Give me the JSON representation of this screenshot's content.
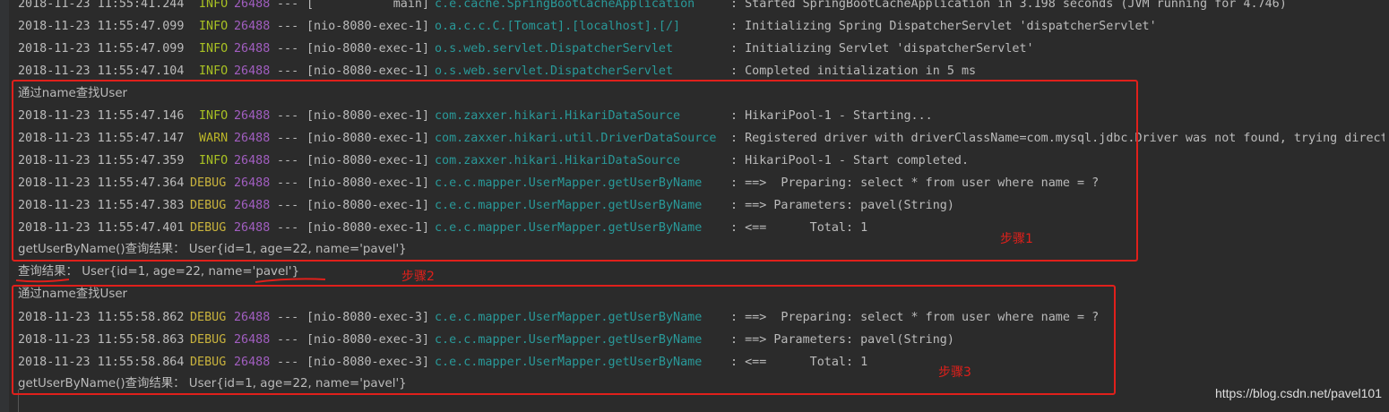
{
  "console": {
    "lines": [
      {
        "date": "2018-11-23 11:55:41.244",
        "level": "INFO",
        "pid": "26488",
        "sep": "---",
        "thread": "[           main]",
        "logger": "c.e.cache.SpringBootCacheApplication",
        "msg": ": Started SpringBootCacheApplication in 3.198 seconds (JVM running for 4.746)"
      },
      {
        "date": "2018-11-23 11:55:47.099",
        "level": "INFO",
        "pid": "26488",
        "sep": "---",
        "thread": "[nio-8080-exec-1]",
        "logger": "o.a.c.c.C.[Tomcat].[localhost].[/]",
        "msg": ": Initializing Spring DispatcherServlet 'dispatcherServlet'"
      },
      {
        "date": "2018-11-23 11:55:47.099",
        "level": "INFO",
        "pid": "26488",
        "sep": "---",
        "thread": "[nio-8080-exec-1]",
        "logger": "o.s.web.servlet.DispatcherServlet",
        "msg": ": Initializing Servlet 'dispatcherServlet'"
      },
      {
        "date": "2018-11-23 11:55:47.104",
        "level": "INFO",
        "pid": "26488",
        "sep": "---",
        "thread": "[nio-8080-exec-1]",
        "logger": "o.s.web.servlet.DispatcherServlet",
        "msg": ": Completed initialization in 5 ms"
      },
      {
        "plain": "通过name查找User"
      },
      {
        "date": "2018-11-23 11:55:47.146",
        "level": "INFO",
        "pid": "26488",
        "sep": "---",
        "thread": "[nio-8080-exec-1]",
        "logger": "com.zaxxer.hikari.HikariDataSource",
        "msg": ": HikariPool-1 - Starting..."
      },
      {
        "date": "2018-11-23 11:55:47.147",
        "level": "WARN",
        "pid": "26488",
        "sep": "---",
        "thread": "[nio-8080-exec-1]",
        "logger": "com.zaxxer.hikari.util.DriverDataSource",
        "msg": ": Registered driver with driverClassName=com.mysql.jdbc.Driver was not found, trying direct"
      },
      {
        "date": "2018-11-23 11:55:47.359",
        "level": "INFO",
        "pid": "26488",
        "sep": "---",
        "thread": "[nio-8080-exec-1]",
        "logger": "com.zaxxer.hikari.HikariDataSource",
        "msg": ": HikariPool-1 - Start completed."
      },
      {
        "date": "2018-11-23 11:55:47.364",
        "level": "DEBUG",
        "pid": "26488",
        "sep": "---",
        "thread": "[nio-8080-exec-1]",
        "logger": "c.e.c.mapper.UserMapper.getUserByName",
        "msg": ": ==>  Preparing: select * from user where name = ?"
      },
      {
        "date": "2018-11-23 11:55:47.383",
        "level": "DEBUG",
        "pid": "26488",
        "sep": "---",
        "thread": "[nio-8080-exec-1]",
        "logger": "c.e.c.mapper.UserMapper.getUserByName",
        "msg": ": ==> Parameters: pavel(String)"
      },
      {
        "date": "2018-11-23 11:55:47.401",
        "level": "DEBUG",
        "pid": "26488",
        "sep": "---",
        "thread": "[nio-8080-exec-1]",
        "logger": "c.e.c.mapper.UserMapper.getUserByName",
        "msg": ": <==      Total: 1"
      },
      {
        "plain": "getUserByName()查询结果： User{id=1, age=22, name='pavel'}"
      },
      {
        "plain": "查询结果： User{id=1, age=22, name='pavel'}"
      },
      {
        "plain": "通过name查找User"
      },
      {
        "date": "2018-11-23 11:55:58.862",
        "level": "DEBUG",
        "pid": "26488",
        "sep": "---",
        "thread": "[nio-8080-exec-3]",
        "logger": "c.e.c.mapper.UserMapper.getUserByName",
        "msg": ": ==>  Preparing: select * from user where name = ?"
      },
      {
        "date": "2018-11-23 11:55:58.863",
        "level": "DEBUG",
        "pid": "26488",
        "sep": "---",
        "thread": "[nio-8080-exec-3]",
        "logger": "c.e.c.mapper.UserMapper.getUserByName",
        "msg": ": ==> Parameters: pavel(String)"
      },
      {
        "date": "2018-11-23 11:55:58.864",
        "level": "DEBUG",
        "pid": "26488",
        "sep": "---",
        "thread": "[nio-8080-exec-3]",
        "logger": "c.e.c.mapper.UserMapper.getUserByName",
        "msg": ": <==      Total: 1"
      },
      {
        "plain": "getUserByName()查询结果： User{id=1, age=22, name='pavel'}"
      }
    ]
  },
  "annotations": {
    "step1": "步骤1",
    "step2": "步骤2",
    "step3": "步骤3"
  },
  "watermark": "https://blog.csdn.net/pavel101",
  "colors": {
    "background": "#2b2b2b",
    "annotation_red": "#e0201b",
    "logger_teal": "#299999",
    "pid_purple": "#a15ec0",
    "info_green": "#a8c023",
    "debug_yellow": "#c9b33d"
  }
}
